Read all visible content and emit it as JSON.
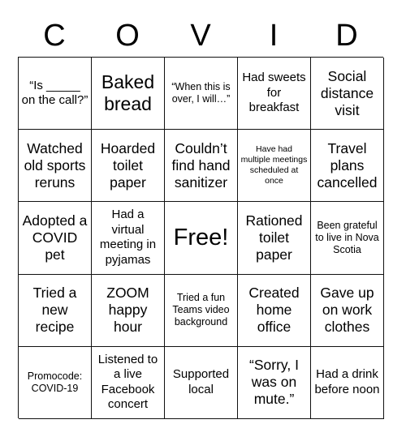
{
  "card": {
    "title_letters": [
      "C",
      "O",
      "V",
      "I",
      "D"
    ],
    "columns": 5,
    "rows": 5,
    "border_color": "#111111",
    "background_color": "#ffffff",
    "text_color": "#000000",
    "cells": [
      {
        "text": "“Is _____ on the call?”",
        "size": "m"
      },
      {
        "text": "Baked bread",
        "size": "xl"
      },
      {
        "text": "“When this is over, I will…”",
        "size": "s"
      },
      {
        "text": "Had sweets for breakfast",
        "size": "m"
      },
      {
        "text": "Social distance visit",
        "size": "l"
      },
      {
        "text": "Watched old sports reruns",
        "size": "l"
      },
      {
        "text": "Hoarded toilet paper",
        "size": "l"
      },
      {
        "text": "Couldn’t find hand sanitizer",
        "size": "l"
      },
      {
        "text": "Have had multiple meetings scheduled at once",
        "size": "xs"
      },
      {
        "text": "Travel plans cancelled",
        "size": "l"
      },
      {
        "text": "Adopted a COVID pet",
        "size": "l"
      },
      {
        "text": "Had a virtual meeting in pyjamas",
        "size": "m"
      },
      {
        "text": "Free!",
        "size": "xxl"
      },
      {
        "text": "Rationed toilet paper",
        "size": "l"
      },
      {
        "text": "Been grateful to live in Nova Scotia",
        "size": "s"
      },
      {
        "text": "Tried a new recipe",
        "size": "l"
      },
      {
        "text": "ZOOM happy hour",
        "size": "l"
      },
      {
        "text": "Tried a fun Teams video background",
        "size": "s"
      },
      {
        "text": "Created home office",
        "size": "l"
      },
      {
        "text": "Gave up on work clothes",
        "size": "l"
      },
      {
        "text": "Promocode: COVID-19",
        "size": "s"
      },
      {
        "text": "Listened to a live Facebook concert",
        "size": "m"
      },
      {
        "text": "Supported local",
        "size": "m"
      },
      {
        "text": "“Sorry, I was on mute.”",
        "size": "l"
      },
      {
        "text": "Had a drink before noon",
        "size": "m"
      }
    ]
  }
}
